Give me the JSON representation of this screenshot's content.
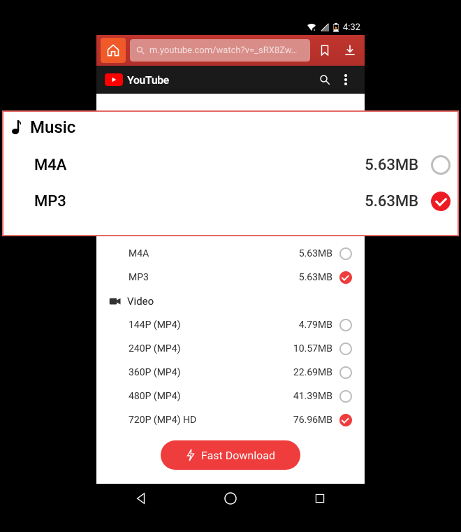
{
  "status": {
    "time": "4:32"
  },
  "urlbar": {
    "url": "m.youtube.com/watch?v=_sRX8Zw…"
  },
  "youtube": {
    "brand": "YouTube"
  },
  "callout": {
    "title": "Music",
    "rows": [
      {
        "format": "M4A",
        "size": "5.63MB",
        "selected": false
      },
      {
        "format": "MP3",
        "size": "5.63MB",
        "selected": true
      }
    ]
  },
  "music_rows": [
    {
      "format": "M4A",
      "size": "5.63MB",
      "selected": false
    },
    {
      "format": "MP3",
      "size": "5.63MB",
      "selected": true
    }
  ],
  "video_section": "Video",
  "video_rows": [
    {
      "format": "144P  (MP4)",
      "size": "4.79MB",
      "selected": false
    },
    {
      "format": "240P  (MP4)",
      "size": "10.57MB",
      "selected": false
    },
    {
      "format": "360P  (MP4)",
      "size": "22.69MB",
      "selected": false
    },
    {
      "format": "480P  (MP4)",
      "size": "41.39MB",
      "selected": false
    },
    {
      "format": "720P  (MP4) HD",
      "size": "76.96MB",
      "selected": true
    }
  ],
  "download_button": "Fast Download"
}
